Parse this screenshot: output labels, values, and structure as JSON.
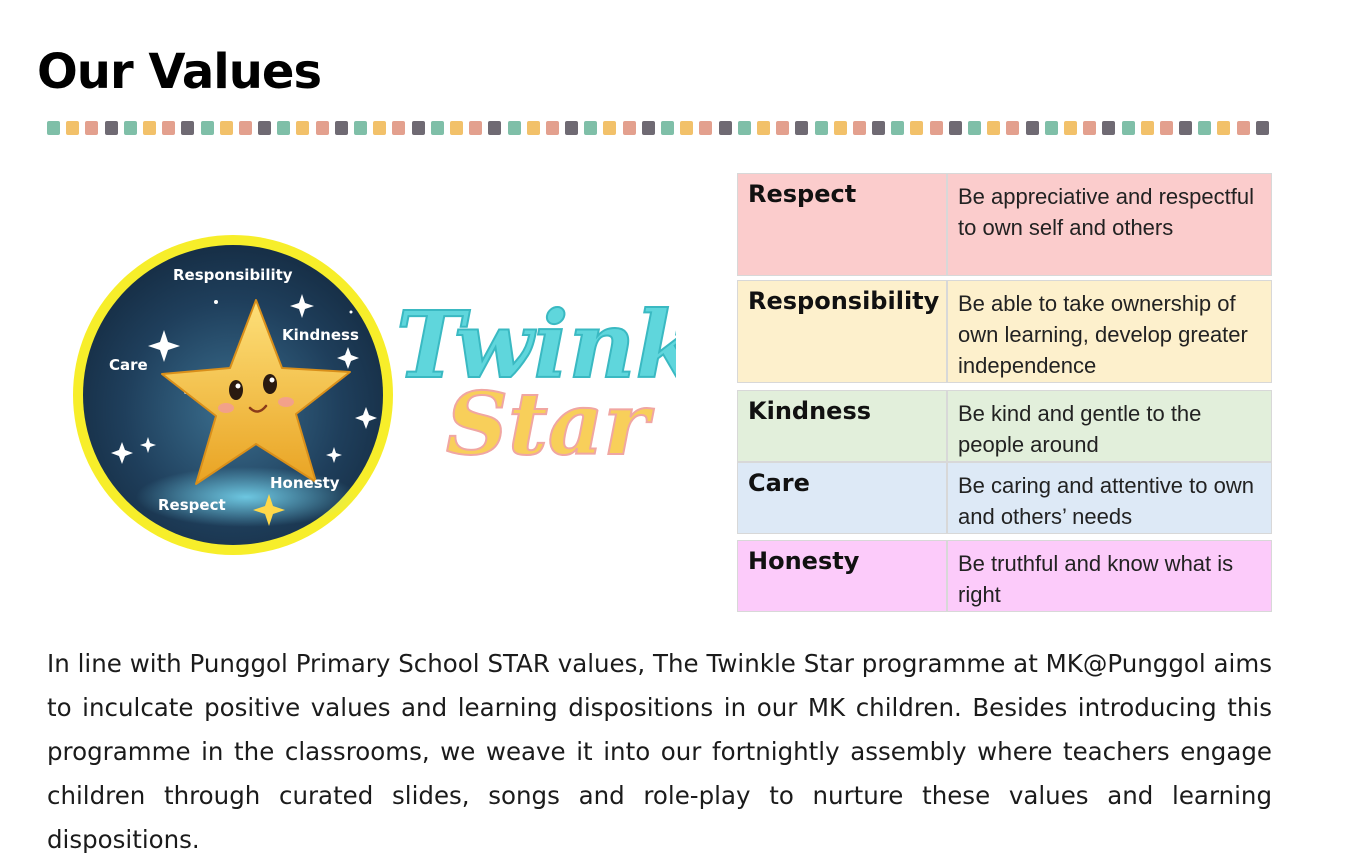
{
  "page": {
    "title": "Our Values"
  },
  "divider": {
    "colors": [
      "#7fbfa8",
      "#f2c16a",
      "#e3a08e",
      "#6f6a73"
    ]
  },
  "logo": {
    "wordmark_line1": "Twinkle",
    "wordmark_line2": "Star",
    "badge_labels": {
      "responsibility": "Responsibility",
      "kindness": "Kindness",
      "care": "Care",
      "honesty": "Honesty",
      "respect": "Respect"
    },
    "colors": {
      "ring": "#f7ee2a",
      "sky": "#1c3a55",
      "star": "#f5b936",
      "wordmark_top": "#5fd6dc",
      "wordmark_bottom": "#f8cf5a"
    }
  },
  "values": [
    {
      "name": "Respect",
      "description": "Be appreciative and respectful to own self and others",
      "color": "#fbcccc"
    },
    {
      "name": "Responsibility",
      "description": "Be able to take ownership of own learning, develop greater independence",
      "color": "#fdf0cc"
    },
    {
      "name": "Kindness",
      "description": "Be kind and gentle to the people around",
      "color": "#e2efdb"
    },
    {
      "name": "Care",
      "description": "Be caring and attentive to own and others’ needs",
      "color": "#dde9f6"
    },
    {
      "name": "Honesty",
      "description": "Be truthful and know what is right",
      "color": "#fccbfa"
    }
  ],
  "body": {
    "paragraph": "In line with Punggol Primary School STAR values, The Twinkle Star programme at MK@Punggol aims to inculcate positive values and learning dispositions in our MK children. Besides introducing this programme in the classrooms, we weave it into our fortnightly assembly where teachers engage children through curated slides, songs and role-play to nurture these values and learning dispositions."
  }
}
